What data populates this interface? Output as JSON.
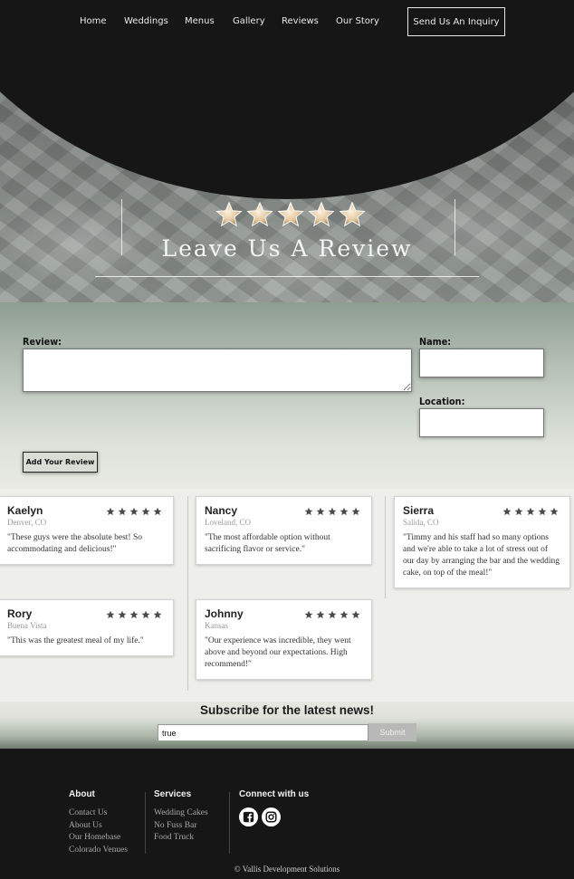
{
  "nav": {
    "items": [
      "Home",
      "Weddings",
      "Menus",
      "Gallery",
      "Reviews",
      "Our Story"
    ],
    "inquiry": "Send Us An Inquiry"
  },
  "hero": {
    "title": "Leave Us A Review",
    "rating_stars": 5
  },
  "form": {
    "review_label": "Review:",
    "name_label": "Name:",
    "location_label": "Location:",
    "review_value": "",
    "name_value": "",
    "location_value": "",
    "submit_label": "Add Your Review"
  },
  "reviews": [
    {
      "name": "Kaelyn",
      "location": "Denver, CO",
      "text": "\"These guys were the absolute best! So accommodating and delicious!\"",
      "stars": 5
    },
    {
      "name": "Nancy",
      "location": "Loveland, CO",
      "text": "\"The most affordable option without sacrificing flavor or service.\"",
      "stars": 5
    },
    {
      "name": "Sierra",
      "location": "Salida, CO",
      "text": "\"Timmy and his staff had so many options and we're able to take a lot of stress out of our day by arranging the bar and the wedding cake, on top of the meal!\"",
      "stars": 5
    },
    {
      "name": "Rory",
      "location": "Buena Vista",
      "text": "\"This was the greatest meal of my life.\"",
      "stars": 5
    },
    {
      "name": "Johnny",
      "location": "Kansas",
      "text": "\"Our experience was incredible, they went above and beyond our expectations. High recommend!\"",
      "stars": 5
    }
  ],
  "subscribe": {
    "heading": "Subscribe for the latest news!",
    "email_value": "true",
    "submit": "Submit"
  },
  "footer": {
    "about": {
      "heading": "About",
      "links": [
        "Contact Us",
        "About Us",
        "Our Homebase",
        "Colorado Venues"
      ]
    },
    "services": {
      "heading": "Services",
      "links": [
        "Wedding Cakes",
        "No Fuss Bar",
        "Food Truck"
      ]
    },
    "connect": {
      "heading": "Connect with us",
      "icons": [
        "facebook-icon",
        "instagram-icon"
      ]
    },
    "copyright": "© Vallis Development Solutions"
  },
  "colors": {
    "background": "#161616",
    "accent": "#8e9d92",
    "star_fill": "#e6c9a0"
  }
}
